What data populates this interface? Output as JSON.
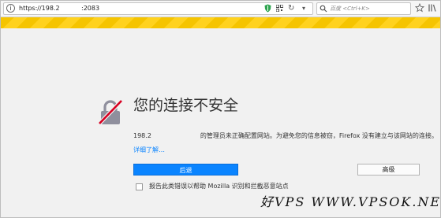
{
  "browser": {
    "url_host": "https://198.2",
    "url_port": ":2083",
    "search_placeholder": "百度 <Ctrl+K>"
  },
  "error_page": {
    "title": "您的连接不安全",
    "description_host": "198.2",
    "description_rest": "的管理员未正确配置网站。为避免您的信息被窃，Firefox 没有建立与该网站的连接。",
    "learn_more": "详细了解…",
    "back_button": "后退",
    "advanced_button": "高级",
    "report_label": "报告此类错误以帮助 Mozilla 识别和拦截恶意站点"
  },
  "watermark": "好VPS WWW.VPSOK.NET",
  "colors": {
    "accent": "#0a84ff",
    "stripe_yellow": "#ffd21e",
    "stripe_dark": "#f5c400",
    "lock_slash": "#d70022"
  }
}
